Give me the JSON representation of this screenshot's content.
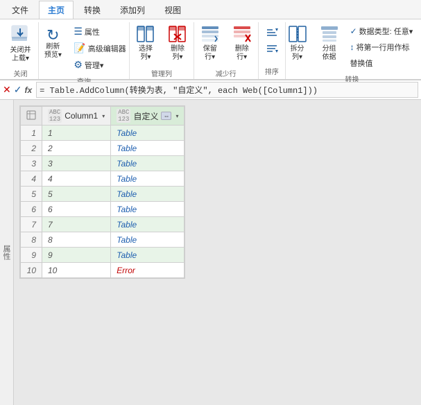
{
  "tabs": [
    {
      "label": "文件",
      "active": false
    },
    {
      "label": "主页",
      "active": true
    },
    {
      "label": "转换",
      "active": false
    },
    {
      "label": "添加列",
      "active": false
    },
    {
      "label": "视图",
      "active": false
    }
  ],
  "ribbon": {
    "groups": [
      {
        "name": "close-group",
        "label": "关闭",
        "buttons": [
          {
            "id": "close-upload",
            "icon": "⬆",
            "label": "关闭并\n上载▾",
            "large": true
          }
        ]
      },
      {
        "name": "query-group",
        "label": "查询",
        "buttons": [
          {
            "id": "refresh",
            "icon": "↻",
            "label": "刷新\n预览▾",
            "large": true
          },
          {
            "id": "properties",
            "icon": "☰",
            "label": "属性",
            "small": true
          },
          {
            "id": "advanced-editor",
            "icon": "📝",
            "label": "高级编辑器",
            "small": true
          },
          {
            "id": "manage",
            "icon": "⚙",
            "label": "管理▾",
            "small": true
          }
        ]
      },
      {
        "name": "manage-cols-group",
        "label": "管理列",
        "buttons": [
          {
            "id": "select-cols",
            "icon": "▦",
            "label": "选择\n列▾",
            "large": true
          },
          {
            "id": "delete-cols",
            "icon": "✖",
            "label": "删除\n列▾",
            "large": true,
            "delete": true
          }
        ]
      },
      {
        "name": "reduce-rows-group",
        "label": "减少行",
        "buttons": [
          {
            "id": "keep-rows",
            "icon": "≡",
            "label": "保留\n行▾",
            "large": true
          },
          {
            "id": "delete-rows",
            "icon": "✖",
            "label": "删除\n行▾",
            "large": true,
            "delete": true
          }
        ]
      },
      {
        "name": "sort-group",
        "label": "排序",
        "buttons": [
          {
            "id": "sort-asc",
            "icon": "↑",
            "label": "↑",
            "small": true
          },
          {
            "id": "sort-desc",
            "icon": "↓",
            "label": "↓",
            "small": true
          }
        ]
      },
      {
        "name": "transform-group",
        "label": "转换",
        "buttons": [
          {
            "id": "split",
            "icon": "⫿",
            "label": "拆分\n列▾",
            "large": true
          },
          {
            "id": "group",
            "icon": "⊞",
            "label": "分组\n依据",
            "large": true
          },
          {
            "id": "datatype",
            "label": "数据类型: 任意▾",
            "small": true
          },
          {
            "id": "first-row",
            "label": "将第一行用作标",
            "small": true
          },
          {
            "id": "replace-value",
            "label": "替换值",
            "small": true
          }
        ]
      }
    ]
  },
  "formula_bar": {
    "formula": "= Table.AddColumn(转换为表, \"自定义\", each Web([Column1]))"
  },
  "table": {
    "columns": [
      {
        "name": "",
        "type": ""
      },
      {
        "name": "Column1",
        "type": "123"
      },
      {
        "name": "自定义",
        "type": "123"
      }
    ],
    "rows": [
      {
        "num": 1,
        "col1": "1",
        "col2": "Table",
        "col2_type": "table"
      },
      {
        "num": 2,
        "col1": "2",
        "col2": "Table",
        "col2_type": "table"
      },
      {
        "num": 3,
        "col1": "3",
        "col2": "Table",
        "col2_type": "table"
      },
      {
        "num": 4,
        "col1": "4",
        "col2": "Table",
        "col2_type": "table"
      },
      {
        "num": 5,
        "col1": "5",
        "col2": "Table",
        "col2_type": "table"
      },
      {
        "num": 6,
        "col1": "6",
        "col2": "Table",
        "col2_type": "table"
      },
      {
        "num": 7,
        "col1": "7",
        "col2": "Table",
        "col2_type": "table"
      },
      {
        "num": 8,
        "col1": "8",
        "col2": "Table",
        "col2_type": "table"
      },
      {
        "num": 9,
        "col1": "9",
        "col2": "Table",
        "col2_type": "table"
      },
      {
        "num": 10,
        "col1": "10",
        "col2": "Error",
        "col2_type": "error"
      }
    ]
  },
  "labels": {
    "close_group": "关闭",
    "query_group": "查询",
    "manage_cols_group": "管理列",
    "reduce_rows_group": "减少行",
    "sort_group": "排序",
    "transform_group": "转换",
    "close_upload": "关闭并",
    "close_upload2": "上载▾",
    "refresh": "刷新",
    "refresh2": "预览▾",
    "properties": "属性",
    "advanced_editor": "高级编辑器",
    "manage": "管理▾",
    "select_cols": "选择",
    "select_cols2": "列▾",
    "delete_cols": "删除",
    "delete_cols2": "列▾",
    "keep_rows": "保留",
    "keep_rows2": "行▾",
    "delete_rows": "删除",
    "delete_rows2": "行▾",
    "split": "拆分",
    "split2": "列▾",
    "group": "分组",
    "group2": "依据",
    "datatype": "数据类型: 任意▾",
    "first_row": "将第一行用作标",
    "replace_value": "替换值",
    "sidebar_label": "属性"
  }
}
